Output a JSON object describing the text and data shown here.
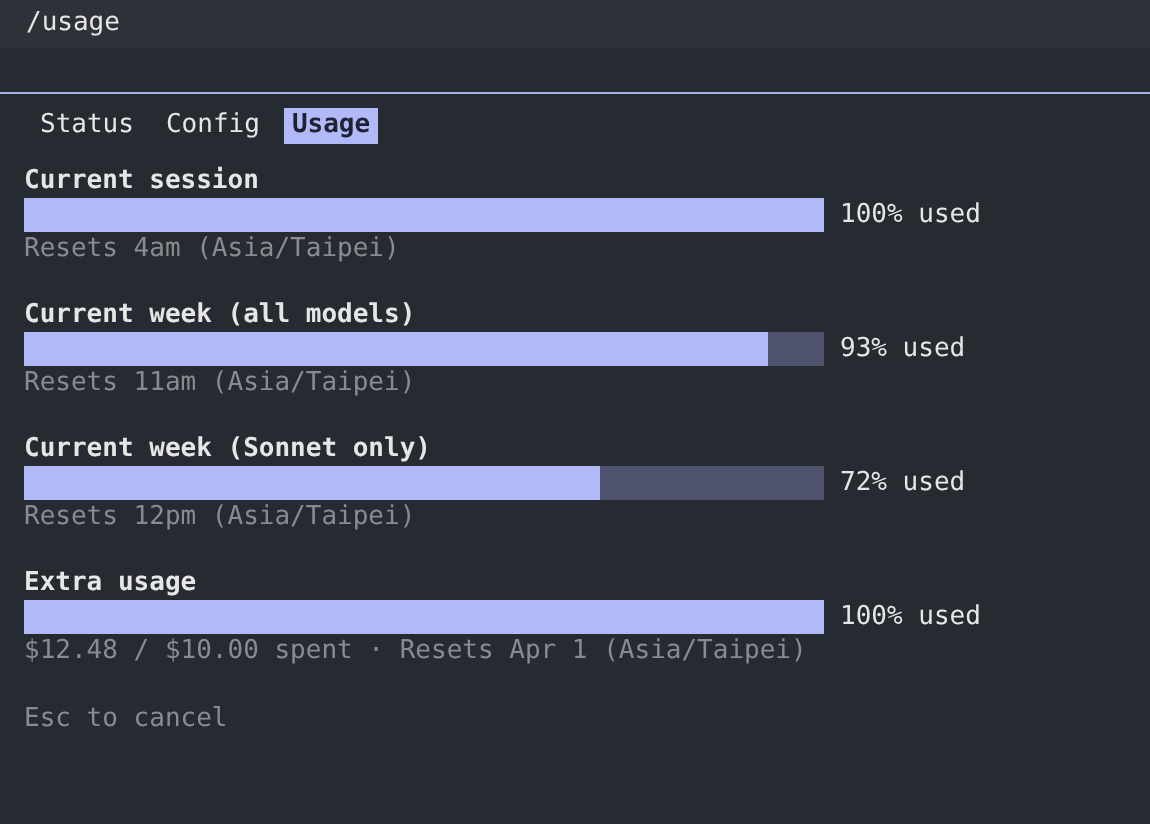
{
  "command": "/usage",
  "tabs": [
    {
      "label": "Status",
      "selected": false
    },
    {
      "label": "Config",
      "selected": false
    },
    {
      "label": "Usage",
      "selected": true
    }
  ],
  "meters": [
    {
      "title": "Current session",
      "level": 1.0,
      "reading": "100% used",
      "note": "Resets 4am (Asia/Taipei)"
    },
    {
      "title": "Current week (all models)",
      "level": 0.93,
      "reading": "93% used",
      "note": "Resets 11am (Asia/Taipei)"
    },
    {
      "title": "Current week (Sonnet only)",
      "level": 0.72,
      "reading": "72% used",
      "note": "Resets 12pm (Asia/Taipei)"
    },
    {
      "title": "Extra usage",
      "level": 1.0,
      "reading": "100% used",
      "note": "$12.48 / $10.00 spent · Resets Apr 1 (Asia/Taipei)"
    }
  ],
  "hint": "Esc to cancel"
}
